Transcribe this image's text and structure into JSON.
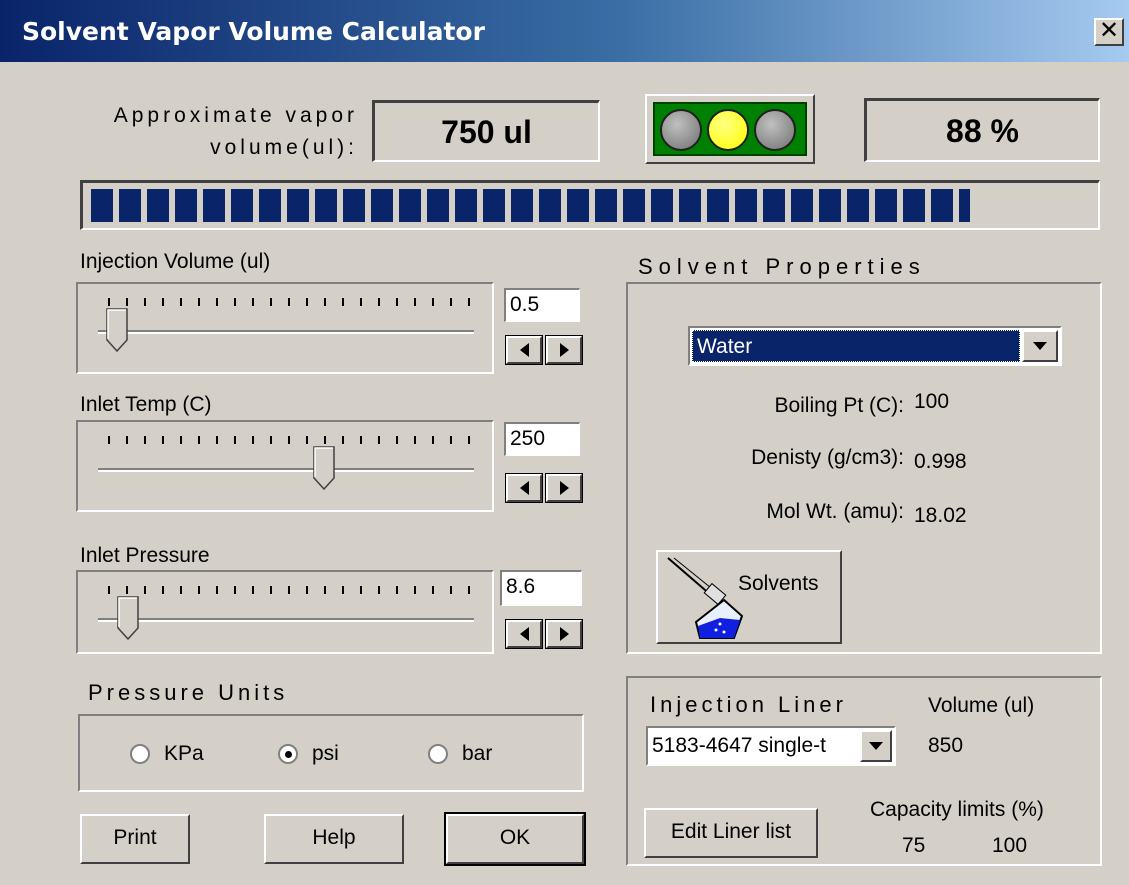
{
  "window": {
    "title": "Solvent Vapor Volume Calculator",
    "close_glyph": "✕"
  },
  "vapor": {
    "label": "Approximate vapor volume(ul):",
    "value": "750 ul",
    "percent": "88 %",
    "progress_fraction": 0.88,
    "indicator_active": "yellow",
    "colors": {
      "progress": "#0a246a",
      "light_panel": "#008000",
      "yellow": "#ffff00",
      "gray": "#808080"
    }
  },
  "injection_volume": {
    "label": "Injection Volume (ul)",
    "value": "0.5",
    "level": 0.05
  },
  "inlet_temp": {
    "label": "Inlet Temp (C)",
    "value": "250",
    "level": 0.6
  },
  "inlet_pressure": {
    "label": "Inlet Pressure",
    "value": "8.6",
    "level": 0.08
  },
  "pressure_units": {
    "title": "Pressure Units",
    "options": [
      {
        "label": "KPa",
        "selected": false
      },
      {
        "label": "psi",
        "selected": true
      },
      {
        "label": "bar",
        "selected": false
      }
    ]
  },
  "buttons": {
    "print": "Print",
    "help": "Help",
    "ok": "OK"
  },
  "solvent": {
    "title": "Solvent Properties",
    "selected": "Water",
    "boiling_label": "Boiling Pt (C):",
    "boiling_value": "100",
    "density_label": "Denisty (g/cm3):",
    "density_value": "0.998",
    "molwt_label": "Mol Wt. (amu):",
    "molwt_value": "18.02",
    "solvents_button": "Solvents"
  },
  "liner": {
    "title": "Injection Liner",
    "selected": "5183-4647 single-t",
    "volume_label": "Volume (ul)",
    "volume_value": "850",
    "edit_button": "Edit Liner list",
    "capacity_label": "Capacity limits (%)",
    "capacity_low": "75",
    "capacity_high": "100"
  }
}
